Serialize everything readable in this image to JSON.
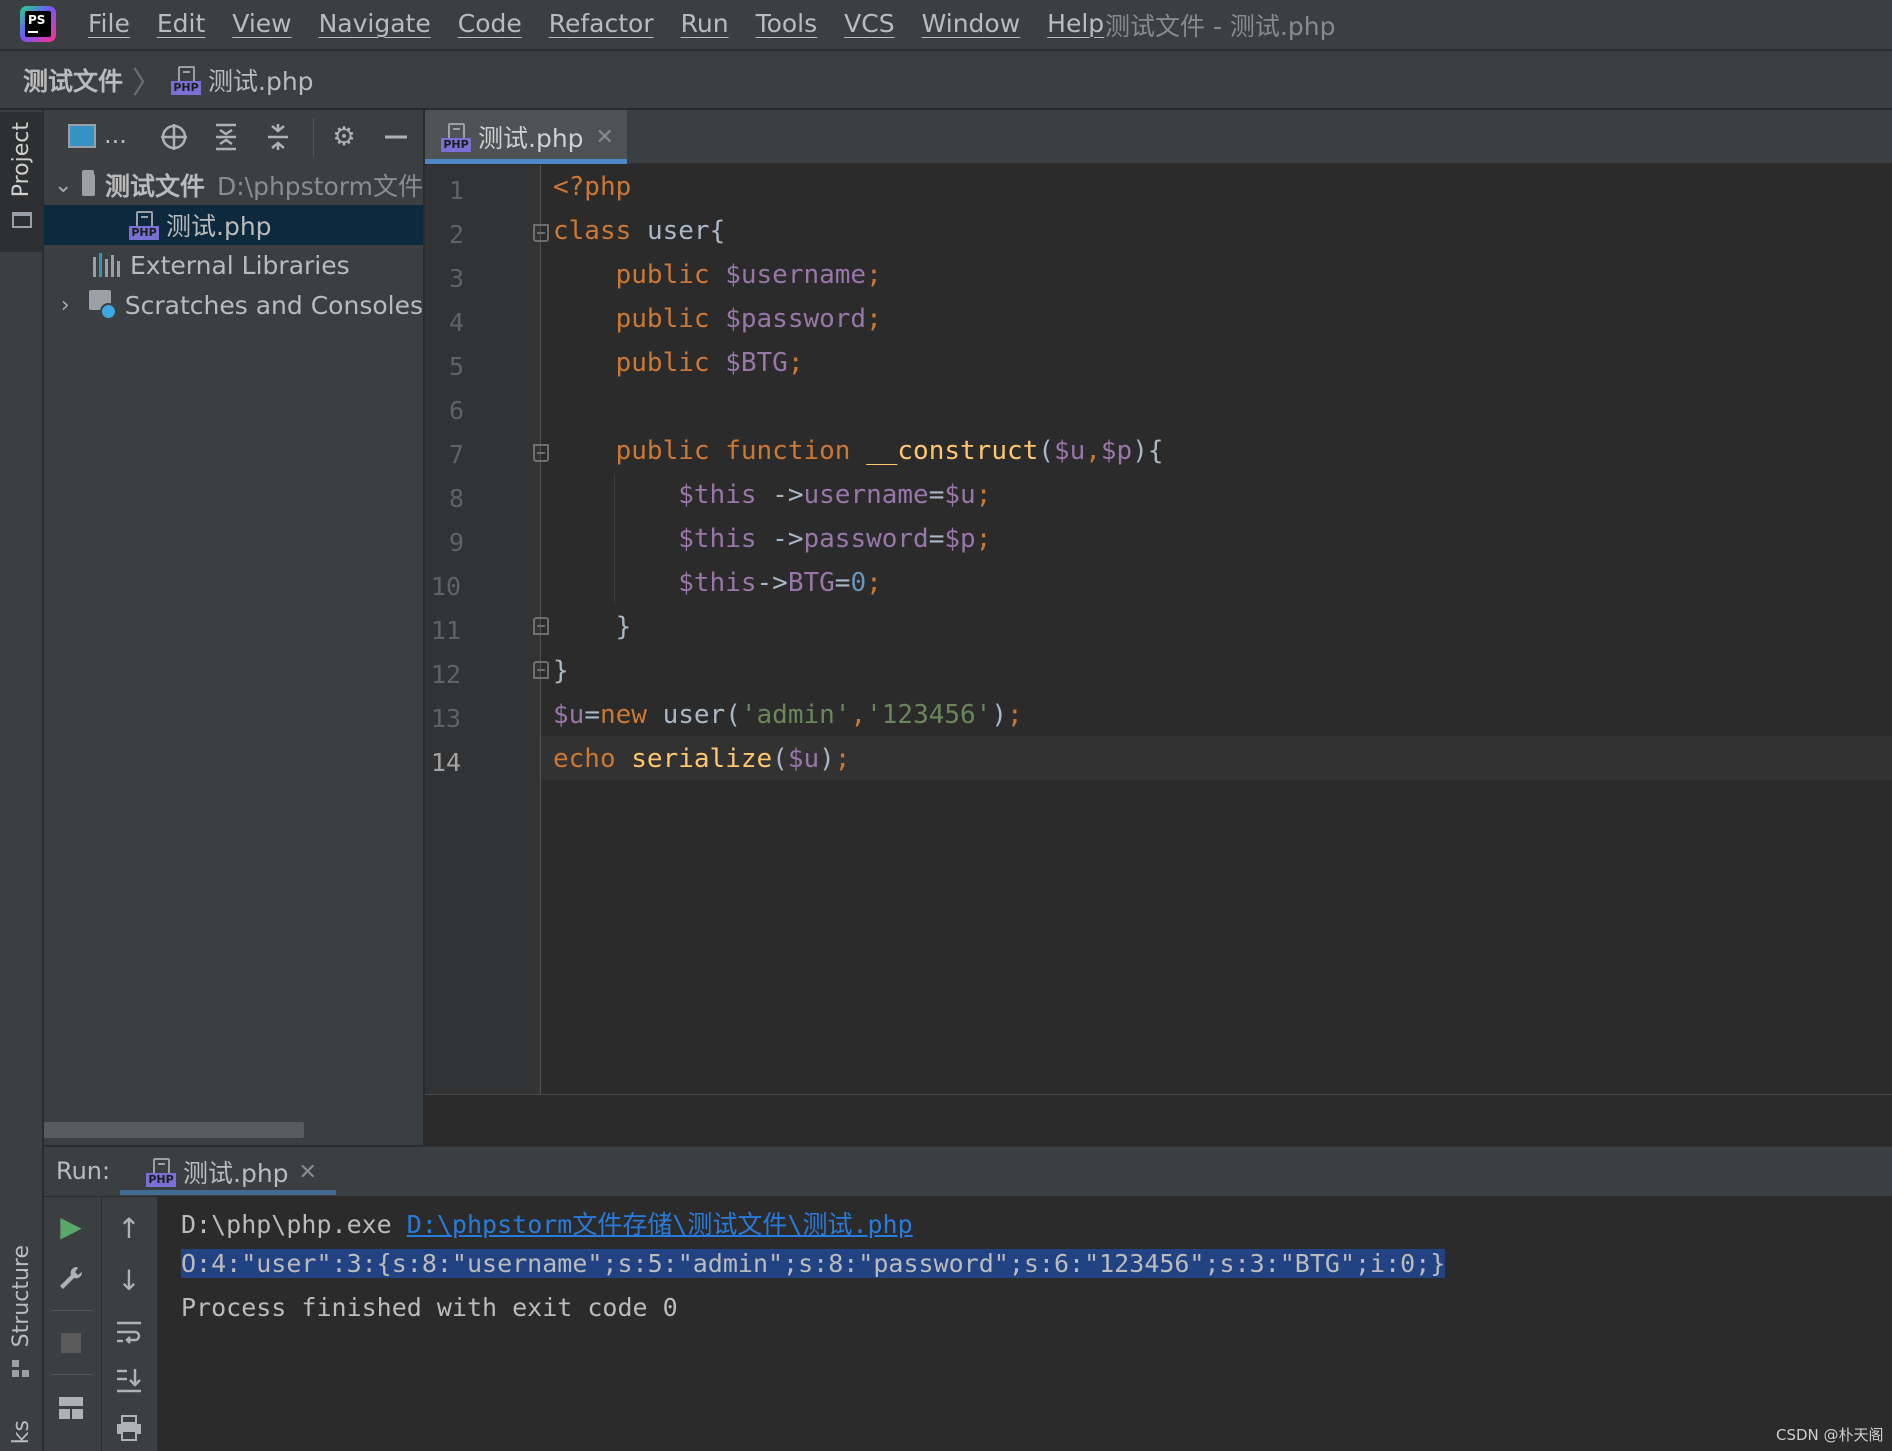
{
  "menu": {
    "items": [
      "File",
      "Edit",
      "View",
      "Navigate",
      "Code",
      "Refactor",
      "Run",
      "Tools",
      "VCS",
      "Window",
      "Help"
    ],
    "window_title": "测试文件 - 测试.php",
    "logo_text": "PS"
  },
  "breadcrumb": {
    "project": "测试文件",
    "file": "测试.php"
  },
  "side_tabs": {
    "project": "Project",
    "structure": "Structure",
    "bookmarks": "ks"
  },
  "project_panel": {
    "view_mode": "...",
    "tree": [
      {
        "label": "测试文件",
        "hint": "D:\\phpstorm文件",
        "expanded": true
      },
      {
        "label": "测试.php",
        "selected": true
      },
      {
        "label": "External Libraries"
      },
      {
        "label": "Scratches and Consoles",
        "expanded": false
      }
    ]
  },
  "editor": {
    "tab_label": "测试.php",
    "current_line": 14,
    "line_numbers": [
      "1",
      "2",
      "3",
      "4",
      "5",
      "6",
      "7",
      "8",
      "9",
      "10",
      "11",
      "12",
      "13",
      "14"
    ],
    "code": [
      "<?php",
      "class user{",
      "    public $username;",
      "    public $password;",
      "    public $BTG;",
      "",
      "    public function __construct($u,$p){",
      "        $this ->username=$u;",
      "        $this ->password=$p;",
      "        $this->BTG=0;",
      "    }",
      "}",
      "$u=new user('admin','123456');",
      "echo serialize($u);"
    ]
  },
  "run_panel": {
    "label": "Run:",
    "tab_label": "测试.php",
    "console": {
      "command": "D:\\php\\php.exe ",
      "link": "D:\\phpstorm文件存储\\测试文件\\测试.php",
      "output": "O:4:\"user\":3:{s:8:\"username\";s:5:\"admin\";s:8:\"password\";s:6:\"123456\";s:3:\"BTG\";i:0;}",
      "status": "Process finished with exit code 0"
    }
  },
  "watermark": "CSDN @朴天阁",
  "colors": {
    "keyword": "#cc7832",
    "variable": "#9876aa",
    "string": "#6a8759",
    "number": "#6897bb",
    "function": "#ffc66d",
    "selection": "#214283",
    "link": "#287bde"
  }
}
